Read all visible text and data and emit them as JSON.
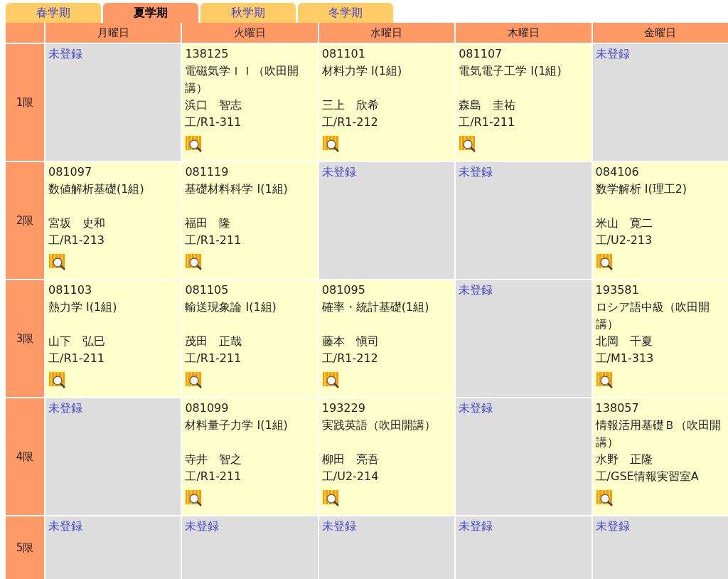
{
  "tabs": [
    {
      "label": "春学期",
      "selected": false
    },
    {
      "label": "夏学期",
      "selected": true
    },
    {
      "label": "秋学期",
      "selected": false
    },
    {
      "label": "冬学期",
      "selected": false
    }
  ],
  "days": [
    "月曜日",
    "火曜日",
    "水曜日",
    "木曜日",
    "金曜日"
  ],
  "periods": [
    {
      "label": "1限",
      "cells": [
        {
          "kind": "empty",
          "label": "未登録"
        },
        {
          "kind": "course",
          "code": "138125",
          "title": "電磁気学ＩＩ（吹田開講）",
          "teacher": "浜口　智志",
          "room": "工/R1-311"
        },
        {
          "kind": "course",
          "code": "081101",
          "title": "材料力学 I(1組)",
          "teacher": "三上　欣希",
          "room": "工/R1-212"
        },
        {
          "kind": "course",
          "code": "081107",
          "title": "電気電子工学 I(1組)",
          "teacher": "森島　圭祐",
          "room": "工/R1-211"
        },
        {
          "kind": "empty",
          "label": "未登録"
        }
      ]
    },
    {
      "label": "2限",
      "cells": [
        {
          "kind": "course",
          "code": "081097",
          "title": "数値解析基礎(1組)",
          "teacher": "宮坂　史和",
          "room": "工/R1-213"
        },
        {
          "kind": "course",
          "code": "081119",
          "title": "基礎材料科学 I(1組)",
          "teacher": "福田　隆",
          "room": "工/R1-211"
        },
        {
          "kind": "empty",
          "label": "未登録"
        },
        {
          "kind": "empty",
          "label": "未登録"
        },
        {
          "kind": "course",
          "code": "084106",
          "title": "数学解析 I(理工2)",
          "teacher": "米山　寛二",
          "room": "工/U2-213"
        }
      ]
    },
    {
      "label": "3限",
      "cells": [
        {
          "kind": "course",
          "code": "081103",
          "title": "熱力学 I(1組)",
          "teacher": "山下　弘巳",
          "room": "工/R1-211"
        },
        {
          "kind": "course",
          "code": "081105",
          "title": "輸送現象論 I(1組)",
          "teacher": "茂田　正哉",
          "room": "工/R1-211"
        },
        {
          "kind": "course",
          "code": "081095",
          "title": "確率・統計基礎(1組)",
          "teacher": "藤本　愼司",
          "room": "工/R1-212"
        },
        {
          "kind": "empty",
          "label": "未登録"
        },
        {
          "kind": "course",
          "code": "193581",
          "title": "ロシア語中級（吹田開講）",
          "teacher": "北岡　千夏",
          "room": "工/M1-313"
        }
      ]
    },
    {
      "label": "4限",
      "cells": [
        {
          "kind": "empty",
          "label": "未登録"
        },
        {
          "kind": "course",
          "code": "081099",
          "title": "材料量子力学 I(1組)",
          "teacher": "寺井　智之",
          "room": "工/R1-211"
        },
        {
          "kind": "course",
          "code": "193229",
          "title": "実践英語（吹田開講）",
          "teacher": "柳田　亮吾",
          "room": "工/U2-214"
        },
        {
          "kind": "empty",
          "label": "未登録"
        },
        {
          "kind": "course",
          "code": "138057",
          "title": "情報活用基礎Ｂ（吹田開講）",
          "teacher": "水野　正隆",
          "room": "工/GSE情報実習室A"
        }
      ]
    },
    {
      "label": "5限",
      "cells": [
        {
          "kind": "empty",
          "label": "未登録"
        },
        {
          "kind": "empty",
          "label": "未登録"
        },
        {
          "kind": "empty",
          "label": "未登録"
        },
        {
          "kind": "empty",
          "label": "未登録"
        },
        {
          "kind": "empty",
          "label": "未登録"
        }
      ]
    }
  ]
}
